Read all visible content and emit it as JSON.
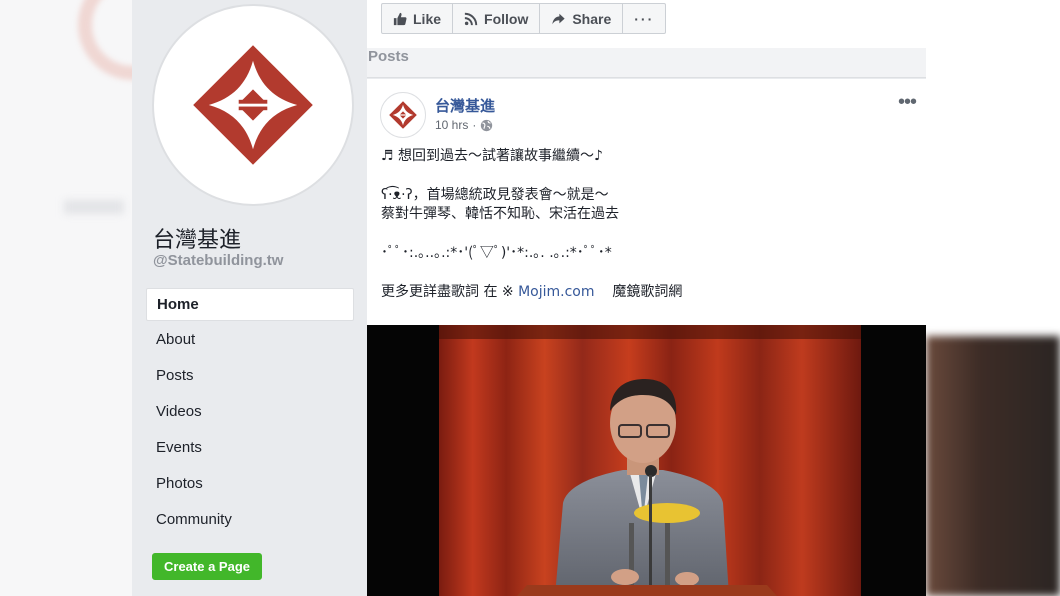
{
  "page": {
    "name": "台灣基進",
    "handle": "@Statebuilding.tw"
  },
  "nav": {
    "items": [
      {
        "label": "Home"
      },
      {
        "label": "About"
      },
      {
        "label": "Posts"
      },
      {
        "label": "Videos"
      },
      {
        "label": "Events"
      },
      {
        "label": "Photos"
      },
      {
        "label": "Community"
      }
    ],
    "active": "Home"
  },
  "create_page_label": "Create a Page",
  "actions": {
    "like": "Like",
    "follow": "Follow",
    "share": "Share",
    "more": "···"
  },
  "posts_header": "Posts",
  "post": {
    "author": "台灣基進",
    "time": "10 hrs",
    "lines": [
      "♬ 想回到過去～試著讓故事繼續～♪",
      "ʕ·͡ᴥ·ʔ，首場總統政見發表會～就是～",
      "蔡對牛彈琴、韓恬不知恥、宋活在過去",
      "･ﾟﾟ･:.｡..｡.:*･'(ﾟ▽ﾟ)'･*:.｡. .｡.:*･ﾟﾟ･*"
    ],
    "lyrics_prefix": "更多更詳盡歌詞 在 ※ ",
    "lyrics_link": "Mojim.com",
    "lyrics_suffix": "魔鏡歌詞網"
  },
  "colors": {
    "logo_red": "#b23a2e",
    "link_blue": "#365899",
    "create_green": "#42b72a"
  }
}
